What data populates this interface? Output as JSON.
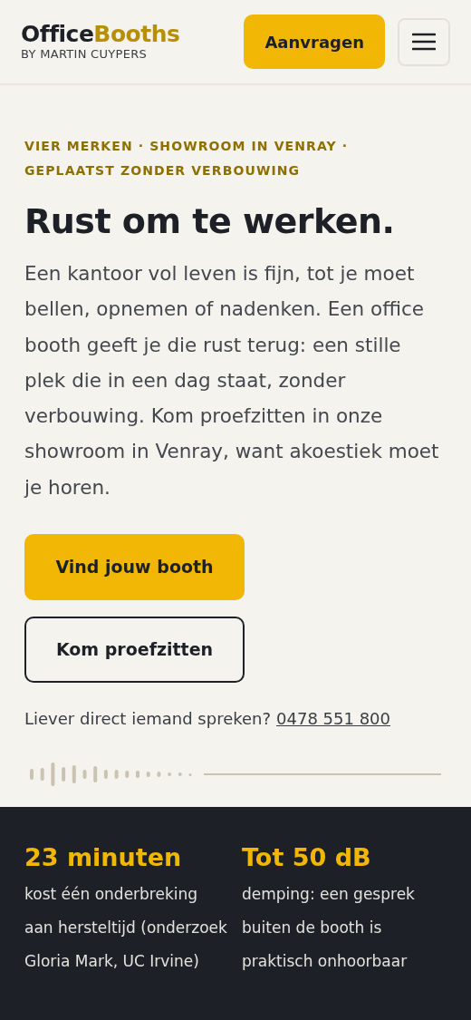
{
  "header": {
    "logo": {
      "part_1": "Office",
      "part_2": "Booths"
    },
    "tagline": "BY MARTIN CUYPERS",
    "cta": "Aanvragen"
  },
  "hero": {
    "eyebrow": "VIER MERKEN · SHOWROOM IN VENRAY · GEPLAATST ZONDER VERBOUWING",
    "title": "Rust om te werken.",
    "body": "Een kantoor vol leven is fijn, tot je moet bellen, opnemen of nadenken. Een office booth geeft je die rust terug: een stille plek die in een dag staat, zonder verbouwing. Kom proefzitten in onze showroom in Venray, want akoestiek moet je horen.",
    "buttons": [
      {
        "label": "Vind jouw booth",
        "kind": "primary"
      },
      {
        "label": "Kom proefzitten",
        "kind": "outline"
      }
    ],
    "contact": {
      "text": "Liever direct iemand spreken?",
      "phone": "0478 551 800"
    }
  },
  "stats": [
    {
      "value": "23 minuten",
      "text": "kost één onderbreking aan hersteltijd (onderzoek Gloria Mark, UC Irvine)"
    },
    {
      "value": "Tot 50 dB",
      "text": "demping: een gesprek buiten de booth is praktisch onhoorbaar"
    }
  ]
}
